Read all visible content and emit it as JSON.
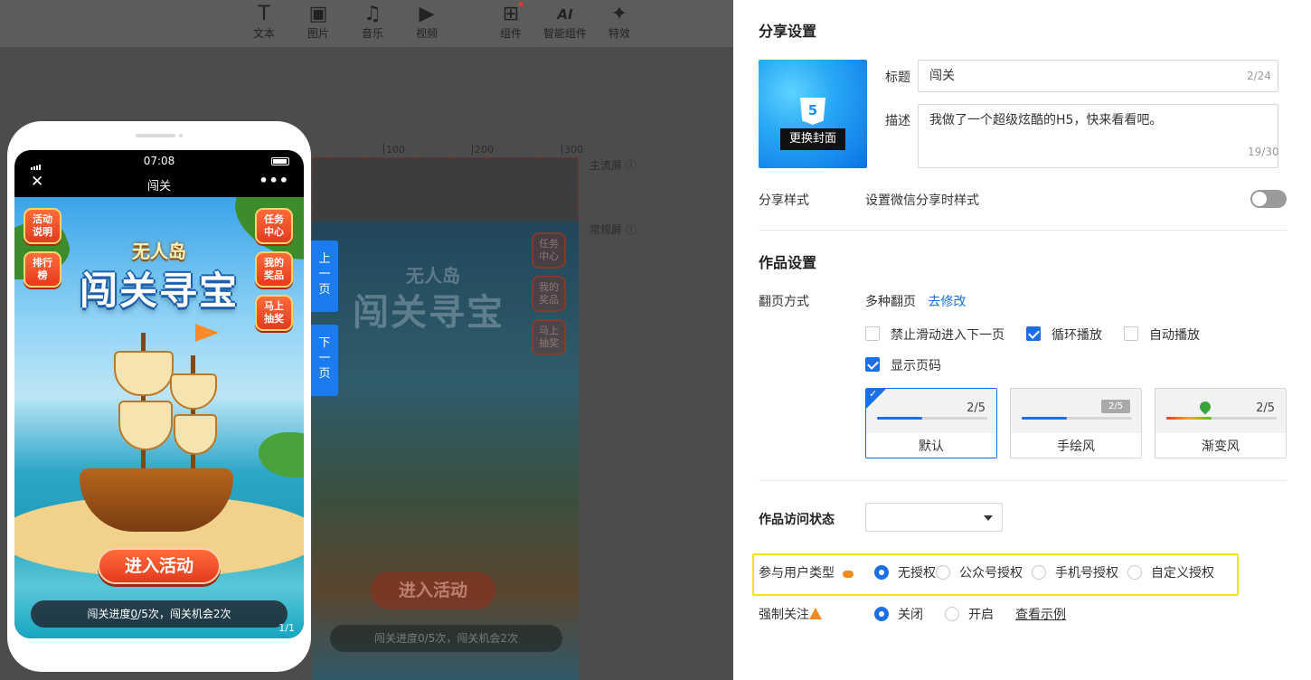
{
  "toolbar": {
    "items": [
      {
        "label": "文本",
        "icon": "text-icon"
      },
      {
        "label": "图片",
        "icon": "image-icon"
      },
      {
        "label": "音乐",
        "icon": "music-icon"
      },
      {
        "label": "视频",
        "icon": "video-icon"
      },
      {
        "label": "组件",
        "icon": "components-icon"
      },
      {
        "label": "智能组件",
        "icon": "ai-component-icon"
      },
      {
        "label": "特效",
        "icon": "effects-icon"
      }
    ]
  },
  "canvas": {
    "ruler": [
      "100",
      "200",
      "300"
    ],
    "main_screen_label": "主流屏",
    "normal_screen_label": "常规屏",
    "prev_page": "上一页",
    "next_page": "下一页"
  },
  "phone": {
    "time": "07:08",
    "nav_title": "闯关",
    "game": {
      "subtitle": "无人岛",
      "title": "闯关寻宝",
      "left_buttons": [
        "活动说明",
        "排行榜"
      ],
      "right_buttons": [
        "任务中心",
        "我的奖品",
        "马上抽奖"
      ],
      "enter_button": "进入活动",
      "progress_prefix": "闯关进度",
      "progress_value": "0",
      "progress_total": "/5",
      "progress_suffix": "次，闯关机会2次",
      "page_indicator": "1/1"
    }
  },
  "panel": {
    "share_heading": "分享设置",
    "cover_button": "更换封面",
    "title_label": "标题",
    "title_value": "闯关",
    "title_count": "2/24",
    "desc_label": "描述",
    "desc_value": "我做了一个超级炫酷的H5，快来看看吧。",
    "desc_count": "19/30",
    "share_style_label": "分享样式",
    "share_style_desc": "设置微信分享时样式",
    "share_style_enabled": false,
    "work_heading": "作品设置",
    "page_turn_label": "翻页方式",
    "page_turn_value": "多种翻页",
    "page_turn_link": "去修改",
    "checkboxes": [
      {
        "label": "禁止滑动进入下一页",
        "checked": false
      },
      {
        "label": "循环播放",
        "checked": true
      },
      {
        "label": "自动播放",
        "checked": false
      },
      {
        "label": "显示页码",
        "checked": true
      }
    ],
    "page_styles": [
      {
        "name": "默认",
        "num": "2/5",
        "selected": true
      },
      {
        "name": "手绘风",
        "num": "2/5",
        "selected": false
      },
      {
        "name": "渐变风",
        "num": "2/5",
        "selected": false
      }
    ],
    "access_label": "作品访问状态",
    "access_value": "",
    "user_type_label": "参与用户类型",
    "user_types": [
      {
        "label": "无授权",
        "selected": true
      },
      {
        "label": "公众号授权",
        "selected": false
      },
      {
        "label": "手机号授权",
        "selected": false
      },
      {
        "label": "自定义授权",
        "selected": false
      }
    ],
    "force_follow_label": "强制关注",
    "force_follow_options": [
      {
        "label": "关闭",
        "selected": true
      },
      {
        "label": "开启",
        "selected": false
      }
    ],
    "example_link": "查看示例"
  },
  "colors": {
    "accent": "#1a6ee6",
    "highlight": "#f5e020",
    "warning": "#f08a24"
  }
}
